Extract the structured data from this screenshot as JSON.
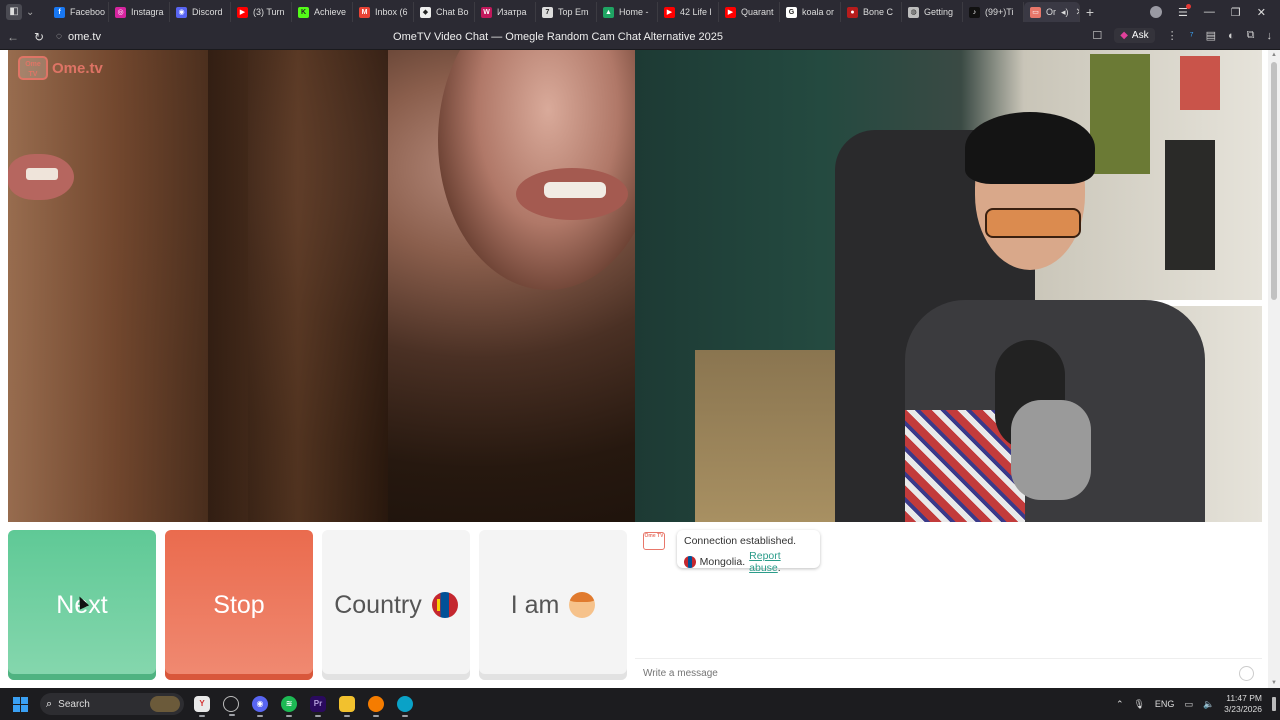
{
  "browser": {
    "tabs": [
      {
        "label": "Faceboo",
        "icon": "facebook-icon",
        "color": "#1877f2",
        "glyph": "f"
      },
      {
        "label": "Instagra",
        "icon": "instagram-icon",
        "color": "#d6249f",
        "glyph": "◎"
      },
      {
        "label": "Discord",
        "icon": "discord-icon",
        "color": "#5865f2",
        "glyph": "◉"
      },
      {
        "label": "(3) Turn",
        "icon": "youtube-icon",
        "color": "#ff0000",
        "glyph": "▶"
      },
      {
        "label": "Achieve",
        "icon": "kick-icon",
        "color": "#53fc18",
        "glyph": "K"
      },
      {
        "label": "Inbox (6",
        "icon": "gmail-icon",
        "color": "#ea4335",
        "glyph": "M"
      },
      {
        "label": "Chat Bo",
        "icon": "chatbot-icon",
        "color": "#eeeeee",
        "glyph": "◆"
      },
      {
        "label": "Изатра",
        "icon": "app-icon",
        "color": "#c2185b",
        "glyph": "W"
      },
      {
        "label": "Top Em",
        "icon": "link-icon",
        "color": "#dddddd",
        "glyph": "7"
      },
      {
        "label": "Home -",
        "icon": "drive-icon",
        "color": "#1fa463",
        "glyph": "▲"
      },
      {
        "label": "42 Life l",
        "icon": "youtube-icon",
        "color": "#ff0000",
        "glyph": "▶"
      },
      {
        "label": "Quarant",
        "icon": "youtube-icon",
        "color": "#ff0000",
        "glyph": "▶"
      },
      {
        "label": "koala or",
        "icon": "google-icon",
        "color": "#ffffff",
        "glyph": "G"
      },
      {
        "label": "Bone C",
        "icon": "bone-icon",
        "color": "#b71c1c",
        "glyph": "●"
      },
      {
        "label": "Getting",
        "icon": "globe-icon",
        "color": "#bdbdbd",
        "glyph": "◍"
      },
      {
        "label": "(99+)Ti",
        "icon": "tiktok-icon",
        "color": "#111111",
        "glyph": "♪"
      }
    ],
    "active_tab": {
      "label": "Or",
      "icon": "ometv-icon",
      "color": "#e8776a",
      "glyph": "▭"
    },
    "url": "ome.tv",
    "page_title": "OmeTV Video Chat — Omegle Random Cam Chat Alternative 2025",
    "ask_label": "Ask"
  },
  "page": {
    "logo_text": "Ome.tv",
    "logo_badge": "Ome TV",
    "buttons": {
      "next": "Next",
      "stop": "Stop",
      "country": "Country",
      "i_am": "I am"
    },
    "chat": {
      "status": "Connection established.",
      "country": "Mongolia.",
      "report": "Report abuse",
      "report_suffix": ".",
      "placeholder": "Write a message"
    }
  },
  "taskbar": {
    "search_label": "Search",
    "language": "ENG",
    "time": "11:47 PM",
    "date": "3/23/2026"
  },
  "colors": {
    "next": "#5fc996",
    "stop": "#ea6b4e",
    "accent_link": "#2b9c8a",
    "brand": "#e8776a"
  }
}
